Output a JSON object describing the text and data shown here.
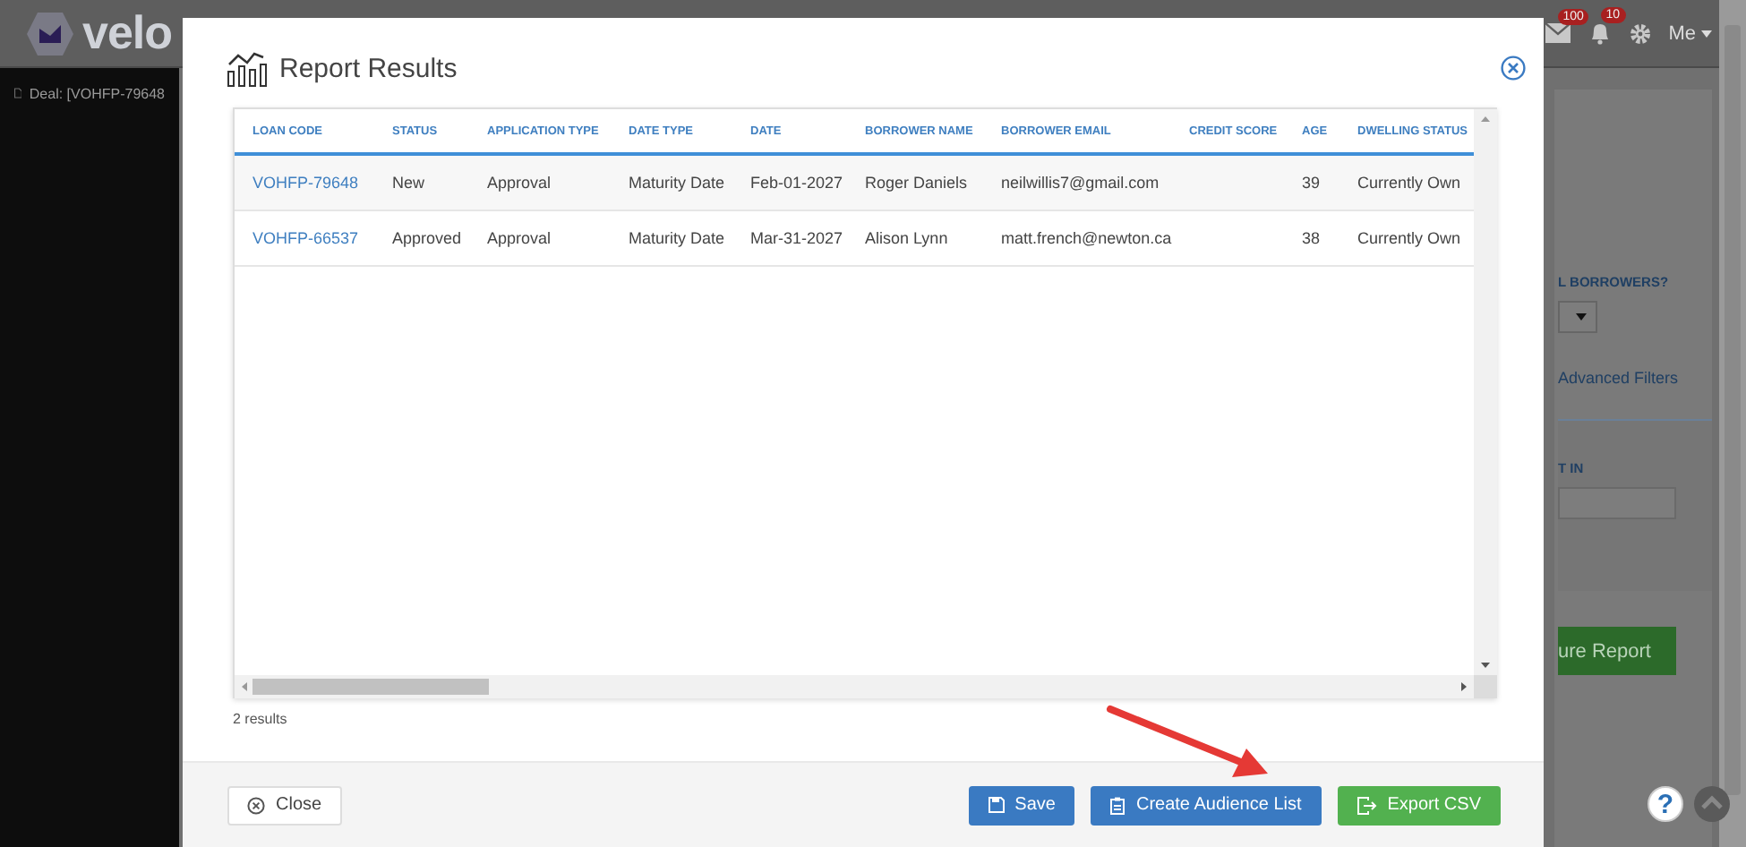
{
  "app_header": {
    "logo_text": "velo",
    "mail_badge": "100",
    "notification_badge": "10",
    "user_menu": "Me"
  },
  "sidebar": {
    "deal_label": "Deal: [VOHFP-79648"
  },
  "filter_panel": {
    "borrowers_label": "L BORROWERS?",
    "advanced_filters_link": "Advanced Filters",
    "field_label": "T IN",
    "run_button": "ure Report"
  },
  "help_button": "?",
  "modal": {
    "title": "Report Results",
    "table": {
      "columns": [
        "LOAN CODE",
        "STATUS",
        "APPLICATION TYPE",
        "DATE TYPE",
        "DATE",
        "BORROWER NAME",
        "BORROWER EMAIL",
        "CREDIT SCORE",
        "AGE",
        "DWELLING STATUS"
      ],
      "rows": [
        {
          "cells": [
            "VOHFP-79648",
            "New",
            "Approval",
            "Maturity Date",
            "Feb-01-2027",
            "Roger Daniels",
            "neilwillis7@gmail.com",
            "",
            "39",
            "Currently Own"
          ]
        },
        {
          "cells": [
            "VOHFP-66537",
            "Approved",
            "Approval",
            "Maturity Date",
            "Mar-31-2027",
            "Alison Lynn",
            "matt.french@newton.ca",
            "",
            "38",
            "Currently Own"
          ]
        }
      ]
    },
    "result_count": "2 results",
    "left_buttons": [
      {
        "label": "Close",
        "kind": "close"
      }
    ],
    "right_buttons": [
      {
        "label": "Save",
        "kind": "save"
      },
      {
        "label": "Create Audience List",
        "kind": "audience"
      },
      {
        "label": "Export CSV",
        "kind": "export"
      }
    ]
  }
}
